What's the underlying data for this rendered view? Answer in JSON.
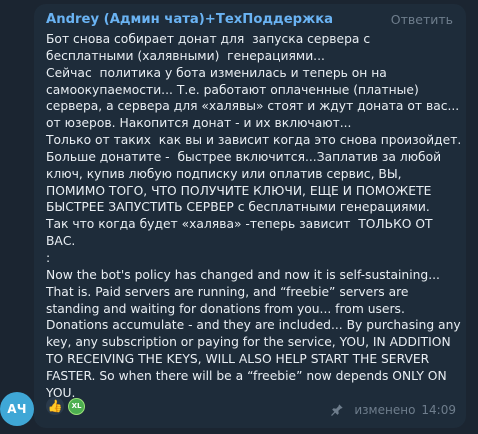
{
  "message": {
    "sender": "Andrey (Админ чата)+ТехПоддержка",
    "reply_label": "Ответить",
    "avatar_initials": "АЧ",
    "text": "Бот снова собирает донат для  запуска сервера с  бесплатными (халявными)  генерациями...\nСейчас  политика у бота изменилась и теперь он на самоокупаемости... Т.е. работают оплаченные (платные) сервера, а сервера для «халявы» стоят и ждут доната от вас... от юзеров. Накопится донат - и их включают...\nТолько от таких  как вы и зависит когда это снова произойдет. Больше донатите -  быстрее включится...Заплатив за любой ключ, купив любую подписку или оплатив сервис, ВЫ, ПОМИМО ТОГО, ЧТО ПОЛУЧИТЕ КЛЮЧИ, ЕЩЕ И ПОМОЖЕТЕ БЫСТРЕЕ ЗАПУСТИТЬ СЕРВЕР с бесплатными генерациями.\nТак что когда будет «халява» -теперь зависит  ТОЛЬКО ОТ ВАС.\n:\nNow the bot's policy has changed and now it is self-sustaining... That is. Paid servers are running, and “freebie” servers are standing and waiting for donations from you... from users. Donations accumulate - and they are included... By purchasing any key, any subscription or paying for the service, YOU, IN ADDITION TO RECEIVING THE KEYS, WILL ALSO HELP START THE SERVER FASTER. So when there will be a “freebie” now depends ONLY ON YOU.",
    "reaction_emoji": "👍",
    "reaction_badge": "XL",
    "edited_label": "изменено",
    "time": "14:09"
  },
  "icons": {
    "pin": "pin-icon",
    "thumbs_up": "thumbs-up-icon"
  },
  "colors": {
    "background": "#1b2531",
    "bubble": "#1e2c3a",
    "sender": "#6ab3f3",
    "text": "#e9eef3",
    "meta": "#6e7d8c",
    "avatar": "#3fa7d6",
    "badge": "#4caf50"
  }
}
